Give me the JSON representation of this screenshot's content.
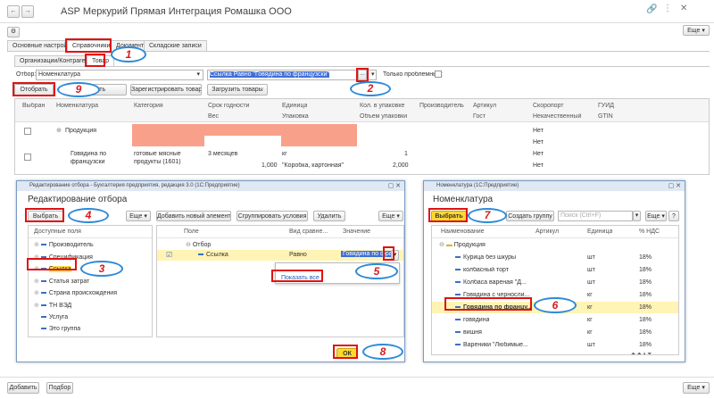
{
  "window": {
    "title": "ASP Меркурий Прямая Интеграция Ромашка ООО",
    "more": "Еще"
  },
  "tabs": [
    "Основные настройки",
    "Справочники",
    "Документы",
    "Складские записи"
  ],
  "subtabs": [
    "Организации/Контрагенты",
    "Товар"
  ],
  "filter": {
    "label": "Отбор:",
    "value": "Номенклатура",
    "condition": "Ссылка Равно \"Говядина по французски\"",
    "only_problem": "Только проблемные:"
  },
  "toolbar": {
    "select": "Отобрать",
    "save": "...ить",
    "register": "Зарегистрировать товары",
    "load": "Загрузить товары"
  },
  "table": {
    "headers1": [
      "Выбран",
      "Номенклатура",
      "Категория",
      "Срок годности",
      "Единица",
      "Кол. в упаковке",
      "Производитель",
      "Артикул",
      "Скоропорт",
      "ГУИД"
    ],
    "headers2": [
      "Вес",
      "Упаковка",
      "Объем упаковки",
      "Гост",
      "Некачественный",
      "GTIN"
    ],
    "group_row": {
      "name": "Продукция",
      "flag": "Нет"
    },
    "row1": {
      "name1": "Говядина по",
      "name2": "французски",
      "cat1": "готовые мясные",
      "cat2": "продукты (1601)",
      "term": "3 месяцев",
      "weight": "1,000",
      "unit": "кг",
      "pack": "\"Коробка, картонная\"",
      "qty": "1",
      "vol": "2,000",
      "flag1": "Нет",
      "flag2": "Нет"
    }
  },
  "filter_dialog": {
    "wtitle": "Редактирование отбора - Бухгалтерия предприятия, редакция 3.0 (1С:Предприятие)",
    "title": "Редактирование отбора",
    "select": "Выбрать",
    "more": "Еще",
    "add": "Добавить новый элемент",
    "group": "Сгруппировать условия",
    "delete": "Удалить",
    "fields_header": "Доступные поля",
    "fields": [
      "Производитель",
      "Спецификация",
      "Ссылка",
      "Статья затрат",
      "Страна происхождения",
      "ТН ВЭД",
      "Услуга",
      "Это группа"
    ],
    "cond_headers": [
      "Поле",
      "Вид сравне...",
      "Значение"
    ],
    "cond_group": "Отбор",
    "cond_row": {
      "field": "Ссылка",
      "cmp": "Равно",
      "value": "Говядина по фра"
    },
    "show_all": "Показать все",
    "ok": "ОК"
  },
  "nom_dialog": {
    "wtitle": "Номенклатура (1С:Предприятие)",
    "title": "Номенклатура",
    "select": "Выбрать",
    "create_group": "Создать группу",
    "search_placeholder": "Поиск (Ctrl+F)",
    "more": "Еще",
    "help": "?",
    "headers": [
      "Наименование",
      "Артикул",
      "Единица",
      "% НДС"
    ],
    "group": "Продукция",
    "items": [
      {
        "name": "Курица без шкуры",
        "unit": "шт",
        "vat": "18%"
      },
      {
        "name": "колбасный торт",
        "unit": "шт",
        "vat": "18%"
      },
      {
        "name": "Колбаса вареная \"Д...",
        "unit": "шт",
        "vat": "18%"
      },
      {
        "name": "Говядина с черносли...",
        "unit": "кг",
        "vat": "18%"
      },
      {
        "name": "Говядина по францу...",
        "unit": "кг",
        "vat": "18%"
      },
      {
        "name": "говядина",
        "unit": "кг",
        "vat": "18%"
      },
      {
        "name": "вишня",
        "unit": "кг",
        "vat": "18%"
      },
      {
        "name": "Вареники \"Любимые...",
        "unit": "шт",
        "vat": "18%"
      }
    ]
  },
  "bottom": {
    "add": "Добавить",
    "select": "Подбор",
    "more": "Еще"
  },
  "steps": [
    "1",
    "2",
    "3",
    "4",
    "5",
    "6",
    "7",
    "8",
    "9"
  ],
  "colors": {
    "accent": "#ffd92e",
    "marker": "#e01212",
    "oval": "#2d8ad8",
    "highlight": "#fff4b5",
    "pink": "#f9a08a"
  }
}
